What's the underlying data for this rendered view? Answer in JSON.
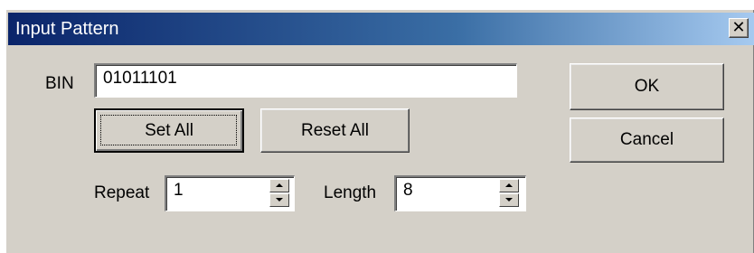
{
  "window": {
    "title": "Input Pattern",
    "close_icon": "close-icon",
    "close_glyph": "✕"
  },
  "bin": {
    "label": "BIN",
    "value": "01011101"
  },
  "buttons": {
    "set_all": "Set All",
    "reset_all": "Reset All",
    "ok": "OK",
    "cancel": "Cancel"
  },
  "repeat": {
    "label": "Repeat",
    "value": "1"
  },
  "length": {
    "label": "Length",
    "value": "8"
  },
  "colors": {
    "titlebar_start": "#0a246a",
    "titlebar_end": "#a6caf0",
    "face": "#d4d0c8"
  }
}
